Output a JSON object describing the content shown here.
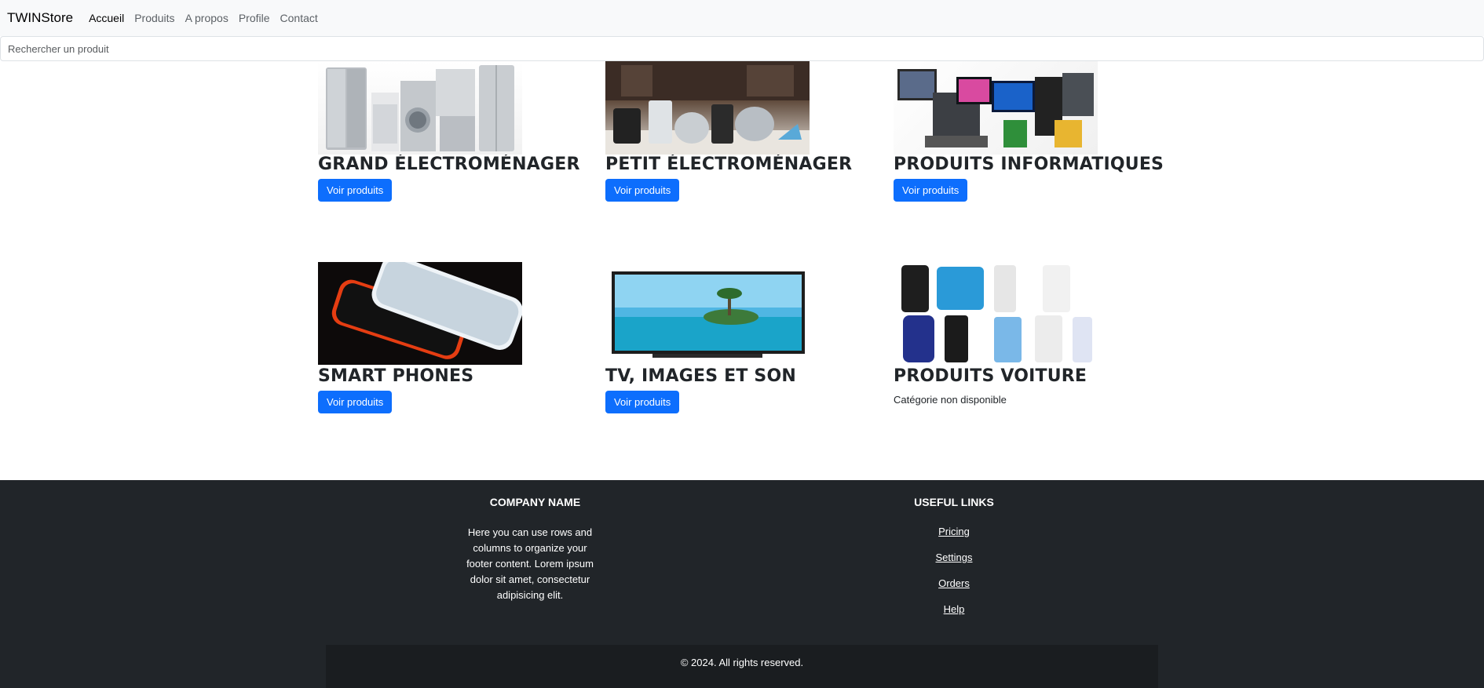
{
  "navbar": {
    "brand": "TWINStore",
    "links": [
      "Accueil",
      "Produits",
      "A propos",
      "Profile",
      "Contact"
    ]
  },
  "search": {
    "placeholder": "Rechercher un produit"
  },
  "categories": [
    {
      "title": "GRAND ÉLECTROMÉNAGER",
      "button": "Voir produits"
    },
    {
      "title": "PETIT ÉLECTROMÉNAGER",
      "button": "Voir produits"
    },
    {
      "title": "PRODUITS INFORMATIQUES",
      "button": "Voir produits"
    },
    {
      "title": "SMART PHONES",
      "button": "Voir produits"
    },
    {
      "title": "TV, IMAGES ET SON",
      "button": "Voir produits"
    },
    {
      "title": "PRODUITS VOITURE",
      "status": "Catégorie non disponible"
    }
  ],
  "footer": {
    "company_heading": "COMPANY NAME",
    "company_text": "Here you can use rows and columns to organize your footer content. Lorem ipsum dolor sit amet, consectetur adipisicing elit.",
    "links_heading": "USEFUL LINKS",
    "links": [
      "Pricing",
      "Settings",
      "Orders",
      "Help"
    ],
    "copyright": "© 2024. All rights reserved."
  },
  "colors": {
    "primary": "#0d6efd",
    "footer_bg": "#212529",
    "navbar_bg": "#f8f9fa"
  }
}
